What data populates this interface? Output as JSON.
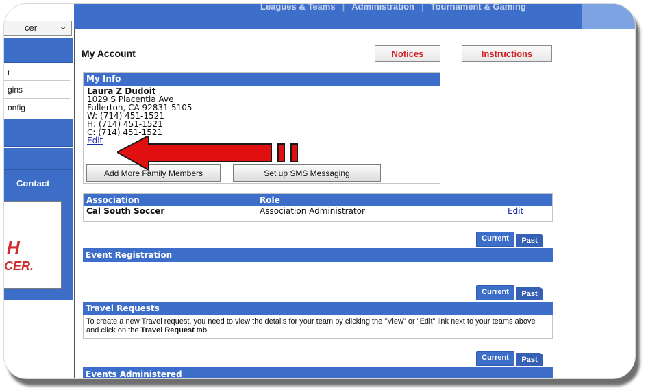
{
  "nav": {
    "select_value": "cer",
    "items": [
      "r",
      "gins",
      "onfig"
    ],
    "contact_label": "Contact",
    "logo_lines": [
      "H",
      "CER."
    ]
  },
  "topnav": {
    "items": [
      "Leagues & Teams",
      "Administration",
      "Tournament & Gaming"
    ]
  },
  "account": {
    "title": "My Account",
    "notices_label": "Notices",
    "instructions_label": "Instructions"
  },
  "my_info": {
    "header": "My Info",
    "name": "Laura Z Dudoit",
    "address1": "1029 S Placentia Ave",
    "address2": "Fullerton, CA 92831-5105",
    "work_phone": "W: (714) 451-1521",
    "home_phone": "H: (714) 451-1521",
    "cell_phone": "C: (714) 451-1521",
    "edit_label": "Edit",
    "add_family_button": "Add More Family Members",
    "sms_button": "Set up SMS Messaging"
  },
  "association_table": {
    "headers": [
      "Association",
      "Role"
    ],
    "rows": [
      {
        "association": "Cal South Soccer",
        "role": "Association Administrator",
        "action": "Edit"
      }
    ]
  },
  "tabs": {
    "current_label": "Current",
    "past_label": "Past"
  },
  "sections": {
    "event_registration": "Event Registration",
    "travel_requests": "Travel Requests",
    "travel_note_prefix": "To create a new Travel request, you need to view the details for your team by clicking the \"View\" or \"Edit\" link next to your teams above and click on the ",
    "travel_note_bold": "Travel Request",
    "travel_note_suffix": " tab.",
    "events_administered": "Events Administered"
  },
  "colors": {
    "header_blue": "#3d6fca",
    "accent_red": "#d42020",
    "link_blue": "#1f2bb5",
    "annotation_red": "#e01010"
  }
}
